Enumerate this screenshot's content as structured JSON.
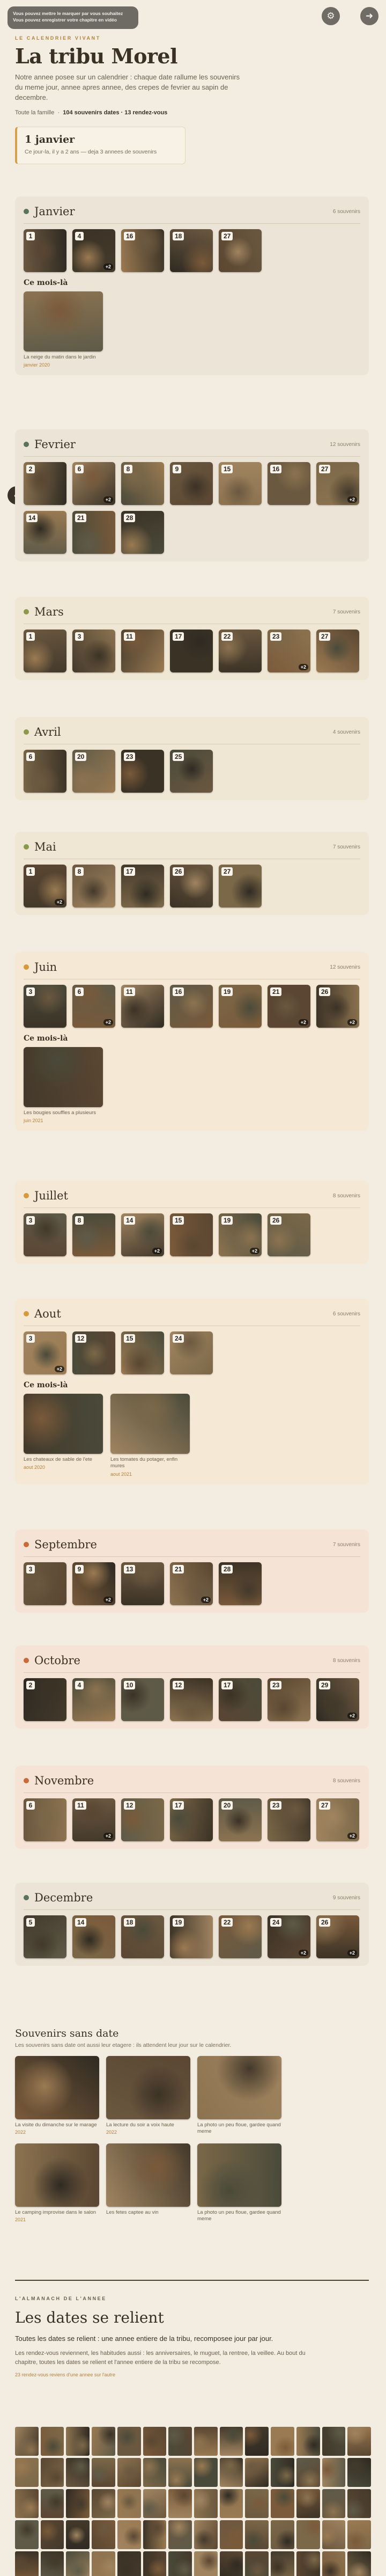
{
  "toast": {
    "line1": "Vous pouvez mettre le marquer par vous souhaitez",
    "line2": "Vous pouvez enregistrer votre chapitre en vidéo"
  },
  "toolbar": {
    "settings_icon": "gear-icon",
    "share_icon": "arrow-icon"
  },
  "header": {
    "eyebrow": "LE CALENDRIER VIVANT",
    "title": "La tribu Morel",
    "intro": "Notre annee posee sur un calendrier : chaque date rallume les souvenirs du meme jour, annee apres annee, des crepes de fevrier au sapin de decembre.",
    "family": "Toute la famille",
    "stats": "104 souvenirs dates · 13 rendez-vous"
  },
  "today": {
    "title": "1 janvier",
    "subtitle": "Ce jour-la, il y a 2 ans — deja 3 annees de souvenirs"
  },
  "months": [
    {
      "name": "Janvier",
      "count": "6 souvenirs",
      "days": [
        "1",
        "4",
        "16",
        "18",
        "27"
      ],
      "more": [
        null,
        "+2",
        null,
        null,
        null
      ],
      "featured": [
        {
          "caption": "La neige du matin dans le jardin",
          "year": "janvier 2020"
        }
      ]
    },
    {
      "name": "Fevrier",
      "count": "12 souvenirs",
      "days": [
        "2",
        "6",
        "8",
        "9",
        "15",
        "16",
        "27",
        "14",
        "21",
        "28"
      ],
      "more": [
        null,
        "+2",
        null,
        null,
        null,
        null,
        "+2",
        null,
        null,
        null
      ],
      "featured": []
    },
    {
      "name": "Mars",
      "count": "7 souvenirs",
      "days": [
        "1",
        "3",
        "11",
        "17",
        "22",
        "23",
        "27"
      ],
      "more": [
        null,
        null,
        null,
        null,
        null,
        "+2",
        null
      ],
      "featured": []
    },
    {
      "name": "Avril",
      "count": "4 souvenirs",
      "days": [
        "6",
        "20",
        "23",
        "25"
      ],
      "more": [
        null,
        null,
        null,
        null
      ],
      "featured": []
    },
    {
      "name": "Mai",
      "count": "7 souvenirs",
      "days": [
        "1",
        "8",
        "17",
        "26",
        "27"
      ],
      "more": [
        "+2",
        null,
        null,
        null,
        null
      ],
      "featured": []
    },
    {
      "name": "Juin",
      "count": "12 souvenirs",
      "days": [
        "3",
        "6",
        "11",
        "16",
        "19",
        "21",
        "26"
      ],
      "more": [
        null,
        "+2",
        null,
        null,
        null,
        "+2",
        "+2"
      ],
      "featured": [
        {
          "caption": "Les bougies souffles a plusieurs",
          "year": "juin 2021"
        }
      ]
    },
    {
      "name": "Juillet",
      "count": "8 souvenirs",
      "days": [
        "3",
        "8",
        "14",
        "15",
        "19",
        "26"
      ],
      "more": [
        null,
        null,
        "+2",
        null,
        "+2",
        null
      ],
      "featured": []
    },
    {
      "name": "Aout",
      "count": "6 souvenirs",
      "days": [
        "3",
        "12",
        "15",
        "24"
      ],
      "more": [
        "+2",
        null,
        null,
        null
      ],
      "featured": [
        {
          "caption": "Les chateaux de sable de l'ete",
          "year": "aout 2020"
        },
        {
          "caption": "Les tomates du potager, enfin mures",
          "year": "aout 2021"
        }
      ]
    },
    {
      "name": "Septembre",
      "count": "7 souvenirs",
      "days": [
        "3",
        "9",
        "13",
        "21",
        "28"
      ],
      "more": [
        null,
        "+2",
        null,
        "+2",
        null
      ],
      "featured": []
    },
    {
      "name": "Octobre",
      "count": "8 souvenirs",
      "days": [
        "2",
        "4",
        "10",
        "12",
        "17",
        "23",
        "29"
      ],
      "more": [
        null,
        null,
        null,
        null,
        null,
        null,
        "+2"
      ],
      "featured": []
    },
    {
      "name": "Novembre",
      "count": "8 souvenirs",
      "days": [
        "6",
        "11",
        "12",
        "17",
        "20",
        "23",
        "27"
      ],
      "more": [
        null,
        "+2",
        null,
        null,
        null,
        null,
        "+2"
      ],
      "featured": []
    },
    {
      "name": "Decembre",
      "count": "9 souvenirs",
      "days": [
        "5",
        "14",
        "18",
        "19",
        "22",
        "24",
        "26"
      ],
      "more": [
        null,
        null,
        null,
        null,
        null,
        "+2",
        "+2"
      ],
      "featured": []
    }
  ],
  "undated": {
    "title": "Souvenirs sans date",
    "subtitle": "Les souvenirs sans date ont aussi leur etagere : ils attendent leur jour sur le calendrier.",
    "items": [
      {
        "caption": "La visite du dimanche sur le marage",
        "year": "2022"
      },
      {
        "caption": "La lecture du soir a voix haute",
        "year": "2022"
      },
      {
        "caption": "La photo un peu floue, gardee quand meme",
        "year": ""
      },
      {
        "caption": "Le camping improvise dans le salon",
        "year": "2021"
      },
      {
        "caption": "Les fetes captee au vin",
        "year": ""
      },
      {
        "caption": "La photo un peu floue, gardee quand meme",
        "year": ""
      }
    ]
  },
  "almanac": {
    "eyebrow": "L'ALMANACH DE L'ANNEE",
    "title": "Les dates se relient",
    "lead": "Toutes les dates se relient : une annee entiere de la tribu, recomposee jour par jour.",
    "body": "Les rendez-vous reviennent, les habitudes aussi : les anniversaires, le muguet, la rentree, la veillee. Au bout du chapitre, toutes les dates se relient et l'annee entiere de la tribu se recompose.",
    "note": "23 rendez-vous reviens d'une annee sur l'autre"
  },
  "colors": {
    "accent": "#b3823d",
    "winter": "#5b7260",
    "spring": "#8a9a4a",
    "summer": "#d49a3c",
    "autumn": "#c96a3a"
  }
}
